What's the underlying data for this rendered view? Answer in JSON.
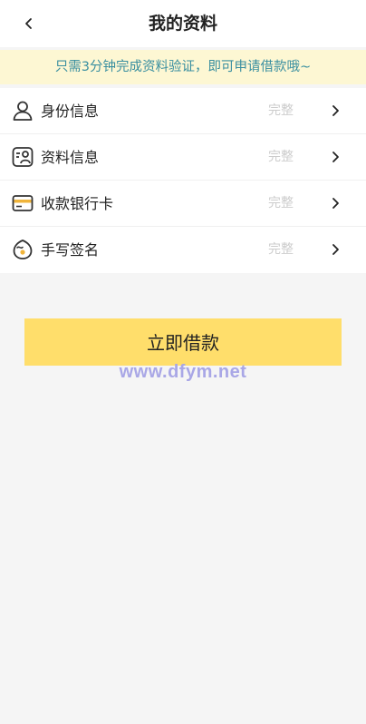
{
  "header": {
    "title": "我的资料",
    "back_icon": "chevron-left-icon"
  },
  "notice": {
    "text": "只需3分钟完成资料验证，即可申请借款哦~",
    "background": "#fdf7d3",
    "color": "#3a8fa0"
  },
  "list": {
    "items": [
      {
        "label": "身份信息",
        "status": "完整",
        "icon": "person-icon"
      },
      {
        "label": "资料信息",
        "status": "完整",
        "icon": "profile-card-icon"
      },
      {
        "label": "收款银行卡",
        "status": "完整",
        "icon": "bank-card-icon"
      },
      {
        "label": "手写签名",
        "status": "完整",
        "icon": "signature-icon"
      }
    ]
  },
  "cta": {
    "label": "立即借款",
    "color": "#ffde6b"
  },
  "watermark": {
    "text": "www.dfym.net"
  }
}
